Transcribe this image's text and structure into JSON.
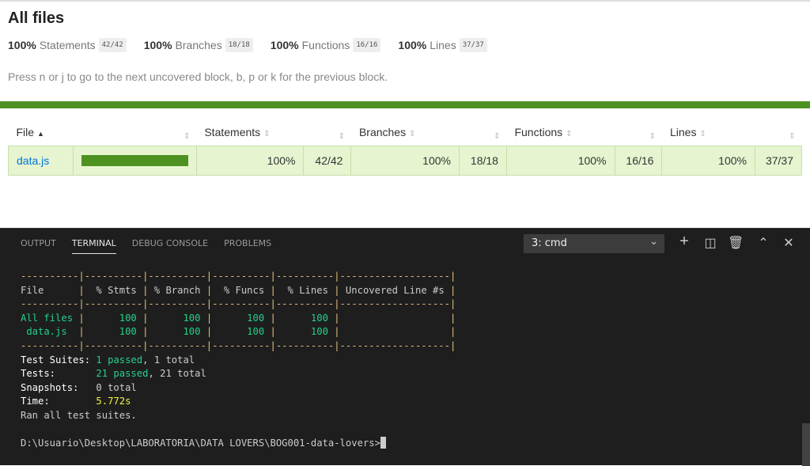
{
  "report": {
    "title": "All files",
    "summary": [
      {
        "pct": "100%",
        "label": "Statements",
        "frac": "42/42"
      },
      {
        "pct": "100%",
        "label": "Branches",
        "frac": "18/18"
      },
      {
        "pct": "100%",
        "label": "Functions",
        "frac": "16/16"
      },
      {
        "pct": "100%",
        "label": "Lines",
        "frac": "37/37"
      }
    ],
    "hint": "Press n or j to go to the next uncovered block, b, p or k for the previous block.",
    "headers": [
      "File",
      "Statements",
      "Branches",
      "Functions",
      "Lines"
    ],
    "row": {
      "file": "data.js",
      "coverage_pct": 100,
      "cells": [
        "100%",
        "42/42",
        "100%",
        "18/18",
        "100%",
        "16/16",
        "100%",
        "37/37"
      ]
    },
    "accent": "#4d9221"
  },
  "terminal": {
    "tabs": [
      "OUTPUT",
      "TERMINAL",
      "DEBUG CONSOLE",
      "PROBLEMS"
    ],
    "active_tab": "TERMINAL",
    "selected": "3: cmd",
    "table_header": [
      "File",
      "% Stmts",
      "% Branch",
      "% Funcs",
      "% Lines",
      "Uncovered Line #s"
    ],
    "rows": [
      [
        "All files",
        "100",
        "100",
        "100",
        "100",
        ""
      ],
      [
        "data.js",
        "100",
        "100",
        "100",
        "100",
        ""
      ]
    ],
    "test_suites": {
      "label": "Test Suites:",
      "passed": "1 passed",
      "rest": ", 1 total"
    },
    "tests": {
      "label": "Tests:",
      "passed": "21 passed",
      "rest": ", 21 total"
    },
    "snapshots": {
      "label": "Snapshots:",
      "value": "0 total"
    },
    "time": {
      "label": "Time:",
      "value": "5.772s"
    },
    "ran": "Ran all test suites.",
    "prompt": "D:\\Usuario\\Desktop\\LABORATORIA\\DATA LOVERS\\BOG001-data-lovers>"
  }
}
